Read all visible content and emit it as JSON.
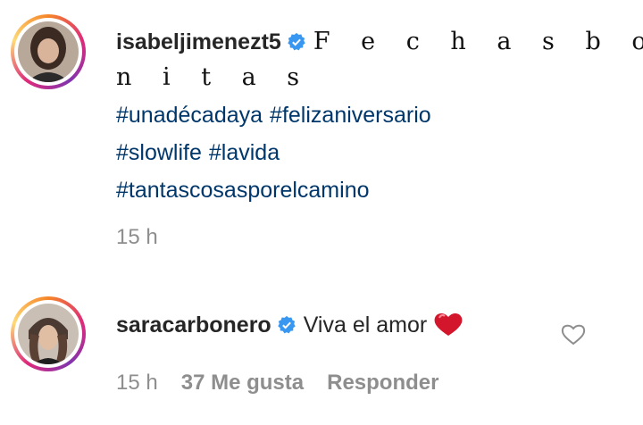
{
  "comments": [
    {
      "username": "isabeljimenezt5",
      "caption_line1": "F e c h a s  b o",
      "caption_line2": "n i t a s",
      "hashtags": [
        "#unadécadaya",
        "#felizaniversario",
        "#slowlife",
        "#lavida",
        "#tantascosasporelcamino"
      ],
      "time": "15 h"
    },
    {
      "username": "saracarbonero",
      "text": "Viva el amor",
      "time": "15 h",
      "likes": "37 Me gusta",
      "reply": "Responder"
    }
  ],
  "icons": {
    "verified": "verified-badge-icon",
    "emoji": "red-heart-emoji",
    "like": "heart-outline-icon"
  },
  "colors": {
    "verified": "#3897f0",
    "hashtag": "#00376b",
    "meta": "#8e8e8e"
  }
}
